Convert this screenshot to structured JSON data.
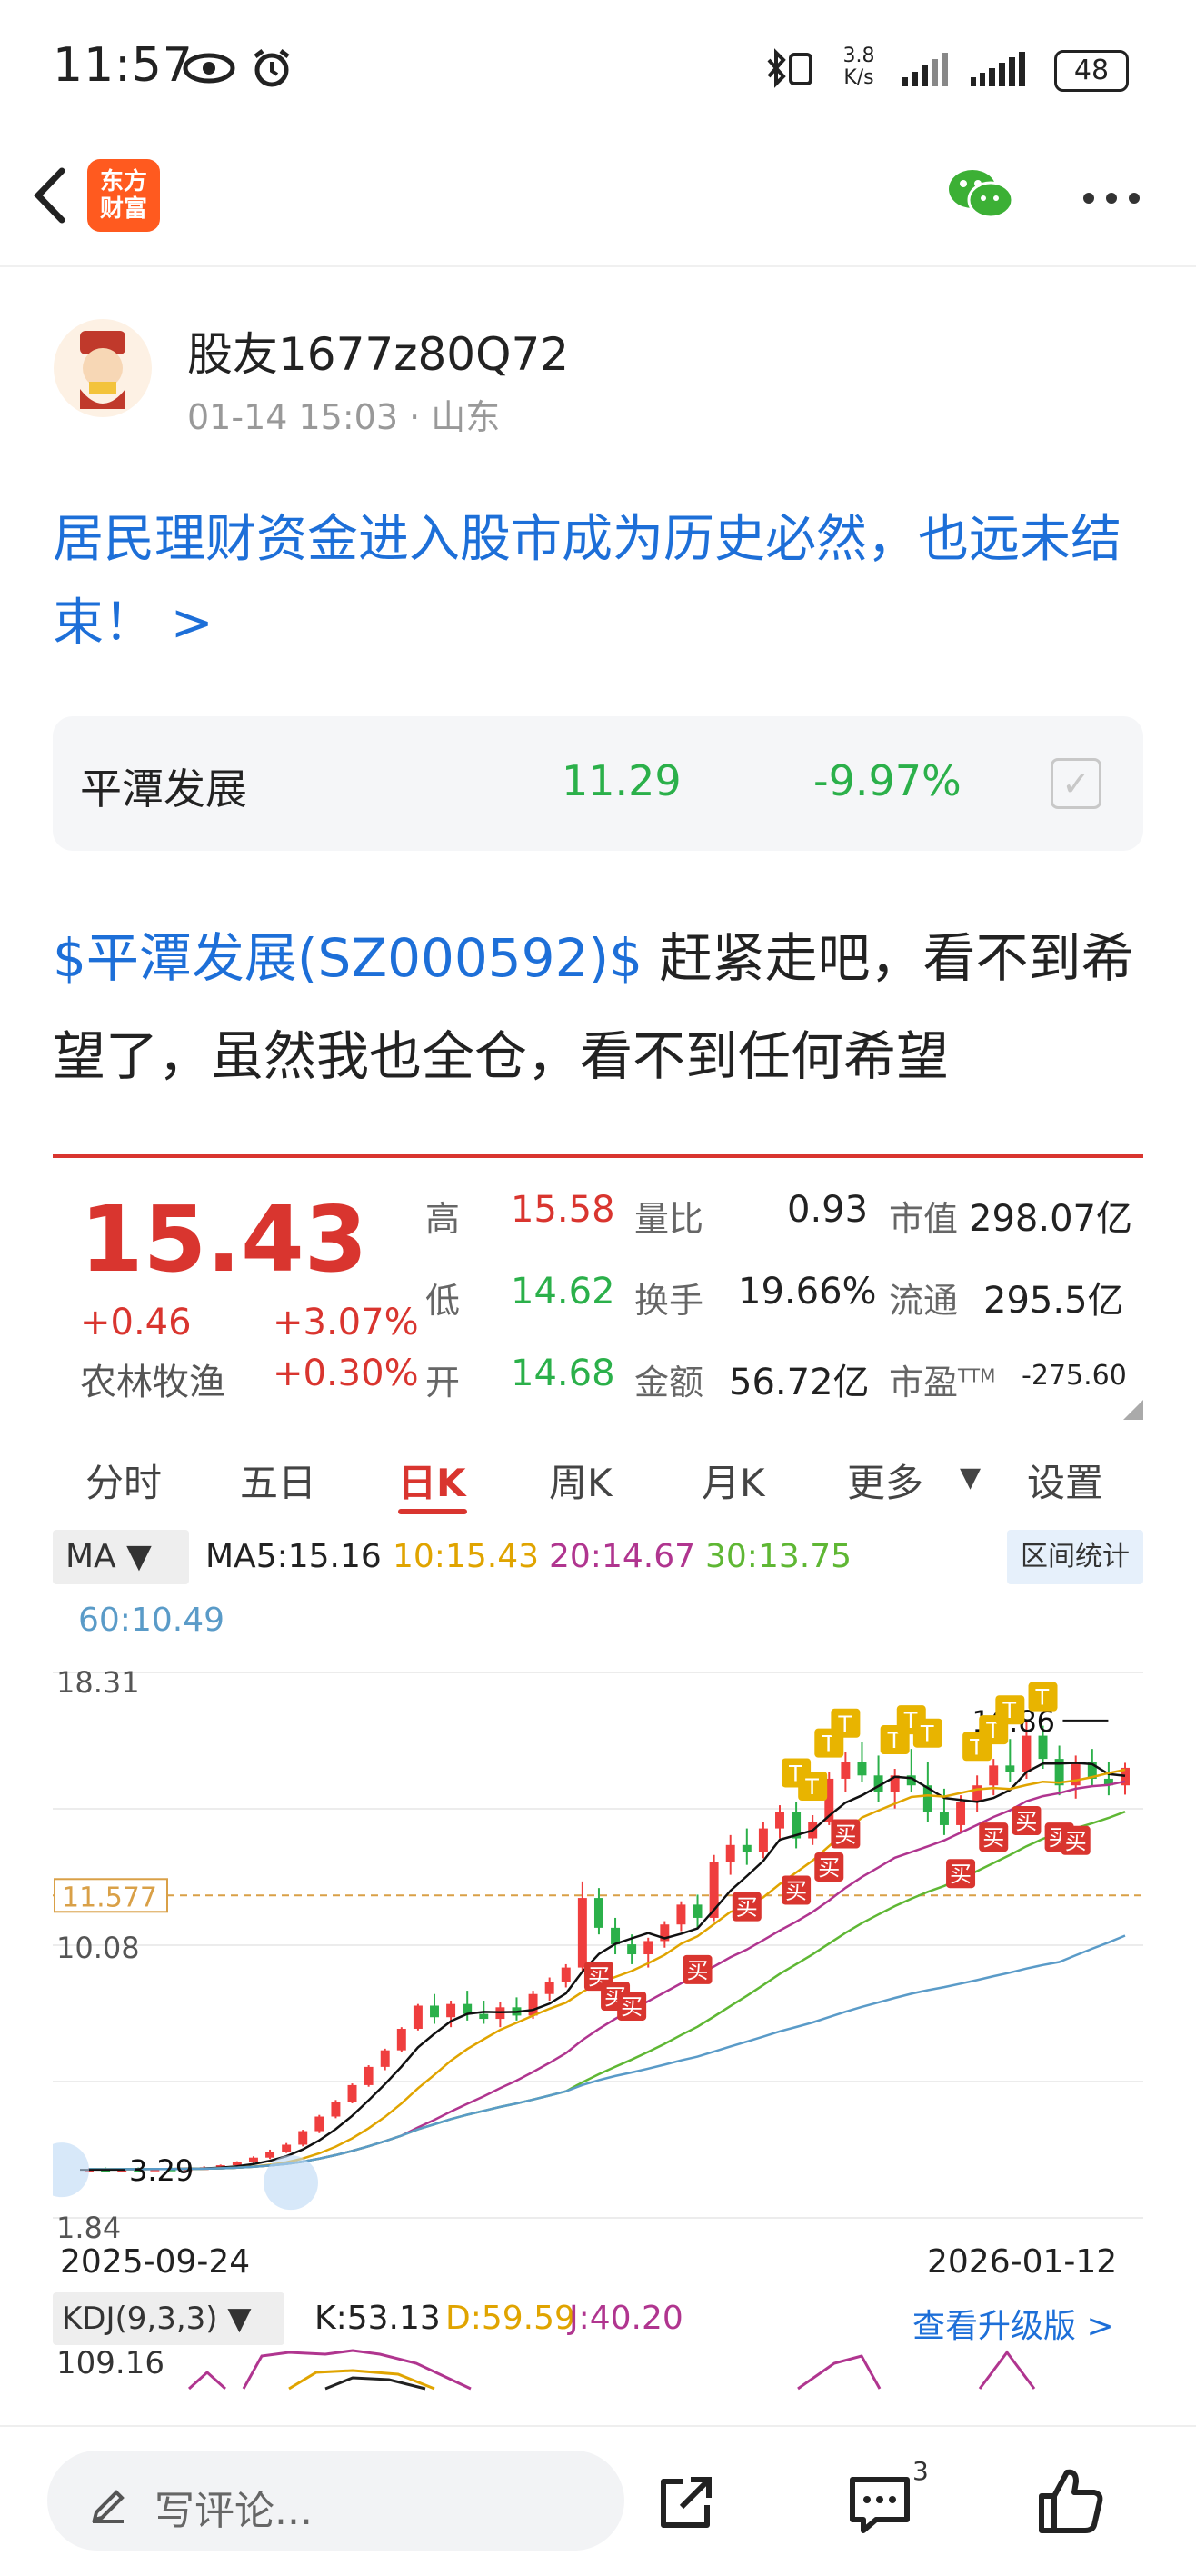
{
  "status_bar": {
    "time": "11:57",
    "net_speed_top": "3.8",
    "net_speed_bottom": "K/s",
    "battery": "48"
  },
  "header": {
    "logo_line1": "东方",
    "logo_line2": "财富"
  },
  "author": {
    "name": "股友1677z80Q72",
    "date": "01-14 15:03",
    "location": "· 山东"
  },
  "post": {
    "title": "居民理财资金进入股市成为历史必然，也远未结束！ >",
    "tag": "$平潭发展(SZ000592)$",
    "text": " 赶紧走吧，看不到希望了，虽然我也全仓，看不到任何希望"
  },
  "stock_card": {
    "name": "平潭发展",
    "price": "11.29",
    "change_pct": "-9.97%",
    "check": "✓"
  },
  "quote": {
    "price": "15.43",
    "change": "+0.46",
    "change_pct": "+3.07%",
    "industry": "农林牧渔",
    "industry_pct": "+0.30%",
    "high_label": "高",
    "high": "15.58",
    "low_label": "低",
    "low": "14.62",
    "open_label": "开",
    "open": "14.68",
    "vol_ratio_label": "量比",
    "vol_ratio": "0.93",
    "turnover_label": "换手",
    "turnover": "19.66%",
    "amount_label": "金额",
    "amount": "56.72亿",
    "mcap_label": "市值",
    "mcap": "298.07亿",
    "float_label": "流通",
    "float_cap": "295.5亿",
    "pe_label": "市盈",
    "pe_sup": "TTM",
    "pe": "-275.60"
  },
  "tabs": [
    "分时",
    "五日",
    "日K",
    "周K",
    "月K",
    "更多",
    "设置"
  ],
  "tab_arrow": "▼",
  "ma": {
    "select": "MA ▼",
    "ma5": "MA5:15.16",
    "ma10": "10:15.43",
    "ma20": "20:14.67",
    "ma30": "30:13.75",
    "ma60": "60:10.49",
    "range_button": "区间统计"
  },
  "chart_labels": {
    "top": "18.31",
    "mid": "10.08",
    "bottom": "1.84",
    "ref_price": "11.577",
    "max_marker": "16.86",
    "min_marker": "3.29",
    "start_date": "2025-09-24",
    "end_date": "2026-01-12",
    "buy": "买",
    "t": "T"
  },
  "chart_data": {
    "type": "candlestick",
    "x_range": [
      "2025-09-24",
      "2026-01-12"
    ],
    "ylim": [
      1.84,
      18.31
    ],
    "y_ticks": [
      18.31,
      10.08,
      1.84
    ],
    "reference_line": 11.577,
    "max_label": 16.86,
    "min_label": 3.29,
    "candles_ohlc": [
      [
        3.3,
        3.34,
        3.27,
        3.31
      ],
      [
        3.31,
        3.36,
        3.28,
        3.3
      ],
      [
        3.3,
        3.33,
        3.27,
        3.32
      ],
      [
        3.32,
        3.36,
        3.29,
        3.31
      ],
      [
        3.31,
        3.34,
        3.28,
        3.33
      ],
      [
        3.33,
        3.37,
        3.3,
        3.32
      ],
      [
        3.32,
        3.35,
        3.29,
        3.34
      ],
      [
        3.34,
        3.4,
        3.31,
        3.37
      ],
      [
        3.37,
        3.45,
        3.34,
        3.43
      ],
      [
        3.43,
        3.55,
        3.4,
        3.52
      ],
      [
        3.52,
        3.7,
        3.48,
        3.66
      ],
      [
        3.66,
        3.9,
        3.62,
        3.84
      ],
      [
        3.84,
        4.1,
        3.8,
        4.05
      ],
      [
        4.05,
        4.5,
        4.0,
        4.46
      ],
      [
        4.46,
        4.95,
        4.4,
        4.9
      ],
      [
        4.9,
        5.4,
        4.85,
        5.35
      ],
      [
        5.35,
        5.9,
        5.3,
        5.85
      ],
      [
        5.85,
        6.45,
        5.8,
        6.4
      ],
      [
        6.4,
        6.95,
        6.3,
        6.9
      ],
      [
        6.9,
        7.6,
        6.85,
        7.55
      ],
      [
        7.55,
        8.3,
        7.5,
        8.25
      ],
      [
        8.25,
        8.6,
        7.7,
        7.9
      ],
      [
        7.9,
        8.4,
        7.6,
        8.3
      ],
      [
        8.3,
        8.7,
        7.8,
        8.0
      ],
      [
        8.0,
        8.4,
        7.7,
        7.85
      ],
      [
        7.85,
        8.35,
        7.6,
        8.2
      ],
      [
        8.2,
        8.5,
        7.8,
        7.95
      ],
      [
        7.95,
        8.7,
        7.85,
        8.6
      ],
      [
        8.6,
        9.1,
        8.4,
        8.95
      ],
      [
        8.95,
        9.5,
        8.8,
        9.4
      ],
      [
        9.4,
        12.0,
        9.3,
        11.5
      ],
      [
        11.5,
        11.8,
        10.4,
        10.6
      ],
      [
        10.6,
        10.9,
        9.8,
        10.1
      ],
      [
        10.1,
        10.4,
        9.5,
        9.8
      ],
      [
        9.8,
        10.3,
        9.4,
        10.2
      ],
      [
        10.2,
        10.8,
        10.0,
        10.7
      ],
      [
        10.7,
        11.4,
        10.5,
        11.3
      ],
      [
        11.3,
        11.6,
        10.6,
        10.9
      ],
      [
        10.9,
        12.8,
        10.8,
        12.6
      ],
      [
        12.6,
        13.4,
        12.2,
        13.1
      ],
      [
        13.1,
        13.6,
        12.5,
        12.9
      ],
      [
        12.9,
        13.8,
        12.7,
        13.6
      ],
      [
        13.6,
        14.3,
        13.3,
        14.1
      ],
      [
        14.1,
        14.4,
        13.0,
        13.3
      ],
      [
        13.3,
        14.0,
        13.1,
        13.8
      ],
      [
        13.8,
        15.3,
        13.7,
        15.1
      ],
      [
        15.1,
        15.9,
        14.7,
        15.6
      ],
      [
        15.6,
        16.2,
        15.0,
        15.2
      ],
      [
        15.2,
        15.8,
        14.4,
        14.7
      ],
      [
        14.7,
        15.4,
        14.2,
        15.2
      ],
      [
        15.2,
        16.0,
        14.7,
        14.9
      ],
      [
        14.9,
        15.6,
        13.8,
        14.1
      ],
      [
        14.1,
        14.8,
        13.4,
        13.7
      ],
      [
        13.7,
        14.6,
        13.5,
        14.4
      ],
      [
        14.4,
        15.2,
        14.1,
        14.9
      ],
      [
        14.9,
        15.7,
        14.6,
        15.5
      ],
      [
        15.5,
        16.3,
        15.0,
        15.3
      ],
      [
        15.3,
        16.86,
        15.1,
        16.4
      ],
      [
        16.4,
        16.7,
        15.4,
        15.7
      ],
      [
        15.7,
        16.1,
        14.6,
        14.9
      ],
      [
        14.9,
        15.8,
        14.5,
        15.6
      ],
      [
        15.6,
        16.0,
        14.9,
        15.1
      ],
      [
        15.1,
        15.6,
        14.6,
        14.9
      ],
      [
        14.9,
        15.58,
        14.62,
        15.43
      ]
    ],
    "series": [
      {
        "name": "MA5",
        "color": "#111111"
      },
      {
        "name": "MA10",
        "color": "#e0a400"
      },
      {
        "name": "MA20",
        "color": "#b0358f"
      },
      {
        "name": "MA30",
        "color": "#5fb734"
      },
      {
        "name": "MA60",
        "color": "#5a9bc8"
      }
    ]
  },
  "kdj": {
    "select": "KDJ(9,3,3) ▼",
    "k": "K:53.13",
    "d": "D:59.59",
    "j": "J:40.20",
    "upgrade": "查看升级版 >",
    "axis_top": "109.16"
  },
  "bottom_bar": {
    "comment_placeholder": "写评论...",
    "comment_count": "3"
  },
  "colors": {
    "up": "#ef3e3e",
    "down": "#2bb04a",
    "link": "#1d6fd8",
    "brand": "#ff5a1f"
  }
}
